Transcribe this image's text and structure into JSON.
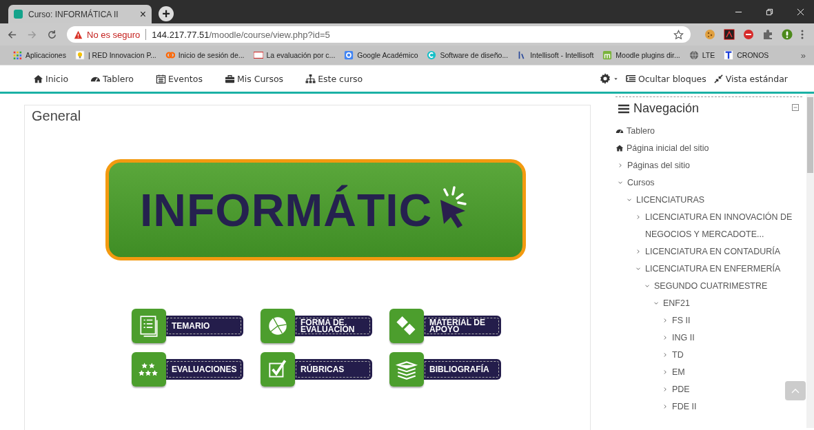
{
  "browser": {
    "tab_title": "Curso: INFORMÁTICA II",
    "tab_close": "×",
    "new_tab": "+",
    "security": "No es seguro",
    "url_host": "144.217.77.51",
    "url_path": "/moodle/course/view.php?id=5",
    "bookmarks": [
      {
        "label": "Aplicaciones"
      },
      {
        "label": "| RED Innovacion P..."
      },
      {
        "label": "Inicio de sesión de..."
      },
      {
        "label": "La evaluación por c..."
      },
      {
        "label": "Google Académico"
      },
      {
        "label": "Software de diseño..."
      },
      {
        "label": "Intellisoft - Intellisoft"
      },
      {
        "label": "Moodle plugins dir..."
      },
      {
        "label": "LTE"
      },
      {
        "label": "CRONOS"
      }
    ],
    "more": "»"
  },
  "navbar": {
    "items": [
      {
        "label": "Inicio"
      },
      {
        "label": "Tablero"
      },
      {
        "label": "Eventos"
      },
      {
        "label": "Mis Cursos"
      },
      {
        "label": "Este curso"
      }
    ],
    "right": [
      {
        "label": "Ocultar bloques"
      },
      {
        "label": "Vista estándar"
      }
    ]
  },
  "section": {
    "title": "General",
    "banner_title": "INFORMÁTIC",
    "buttons": [
      {
        "label": "TEMARIO"
      },
      {
        "label": "FORMA DE EVALUACIÓN"
      },
      {
        "label": "MATERIAL DE APOYO"
      },
      {
        "label": "EVALUACIONES"
      },
      {
        "label": "RÚBRICAS"
      },
      {
        "label": "BIBLIOGRAFÍA"
      }
    ]
  },
  "navigation": {
    "title": "Navegación",
    "items": [
      {
        "label": "Tablero",
        "kind": "dashboard"
      },
      {
        "label": "Página inicial del sitio",
        "kind": "home"
      },
      {
        "label": "Páginas del sitio",
        "kind": "branch",
        "expanded": false
      },
      {
        "label": "Cursos",
        "kind": "branch",
        "expanded": true,
        "children": [
          {
            "label": "LICENCIATURAS",
            "kind": "branch",
            "expanded": true,
            "children": [
              {
                "label": "LICENCIATURA EN INNOVACIÓN DE NEGOCIOS Y MERCADOTE...",
                "kind": "branch",
                "expanded": false
              },
              {
                "label": "LICENCIATURA EN CONTADURÍA",
                "kind": "branch",
                "expanded": false
              },
              {
                "label": "LICENCIATURA EN ENFERMERÍA",
                "kind": "branch",
                "expanded": true,
                "children": [
                  {
                    "label": "SEGUNDO CUATRIMESTRE",
                    "kind": "branch",
                    "expanded": true,
                    "children": [
                      {
                        "label": "ENF21",
                        "kind": "branch",
                        "expanded": true,
                        "children": [
                          {
                            "label": "FS II",
                            "kind": "branch",
                            "expanded": false
                          },
                          {
                            "label": "ING II",
                            "kind": "branch",
                            "expanded": false
                          },
                          {
                            "label": "TD",
                            "kind": "branch",
                            "expanded": false
                          },
                          {
                            "label": "EM",
                            "kind": "branch",
                            "expanded": false
                          },
                          {
                            "label": "PDE",
                            "kind": "branch",
                            "expanded": false
                          },
                          {
                            "label": "FDE II",
                            "kind": "branch",
                            "expanded": false
                          }
                        ]
                      }
                    ]
                  }
                ]
              }
            ]
          }
        ]
      }
    ]
  }
}
